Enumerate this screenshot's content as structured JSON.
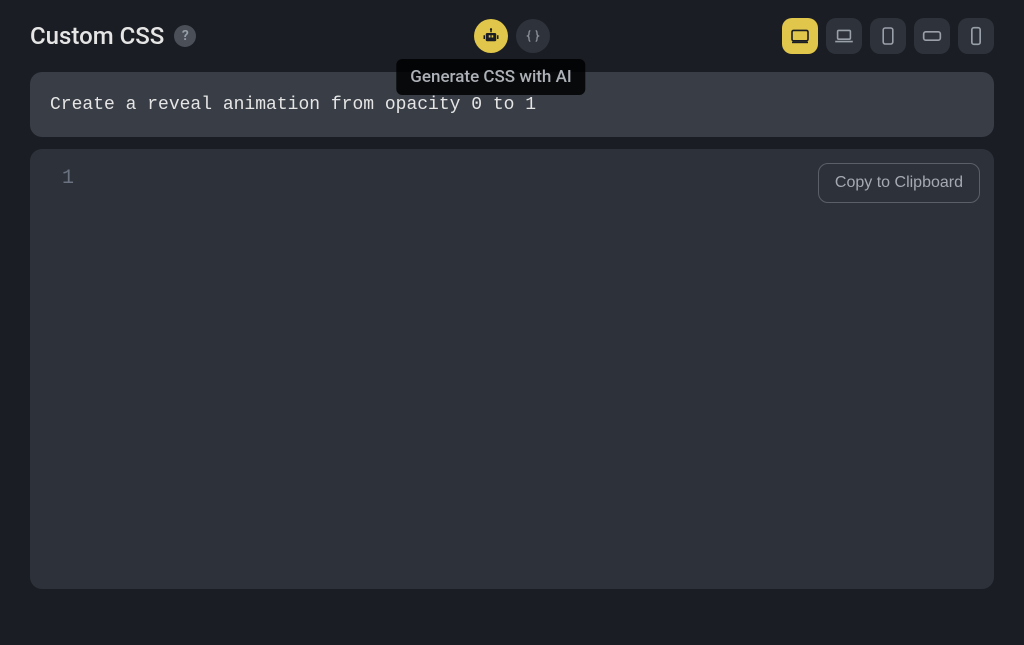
{
  "header": {
    "title": "Custom CSS",
    "help_glyph": "?",
    "ai_button_tooltip": "Generate CSS with AI"
  },
  "input": {
    "value": "Create a reveal animation from opacity 0 to 1"
  },
  "editor": {
    "first_line_number": "1",
    "copy_label": "Copy to Clipboard"
  },
  "device_toggles": {
    "desktop_active": true
  }
}
